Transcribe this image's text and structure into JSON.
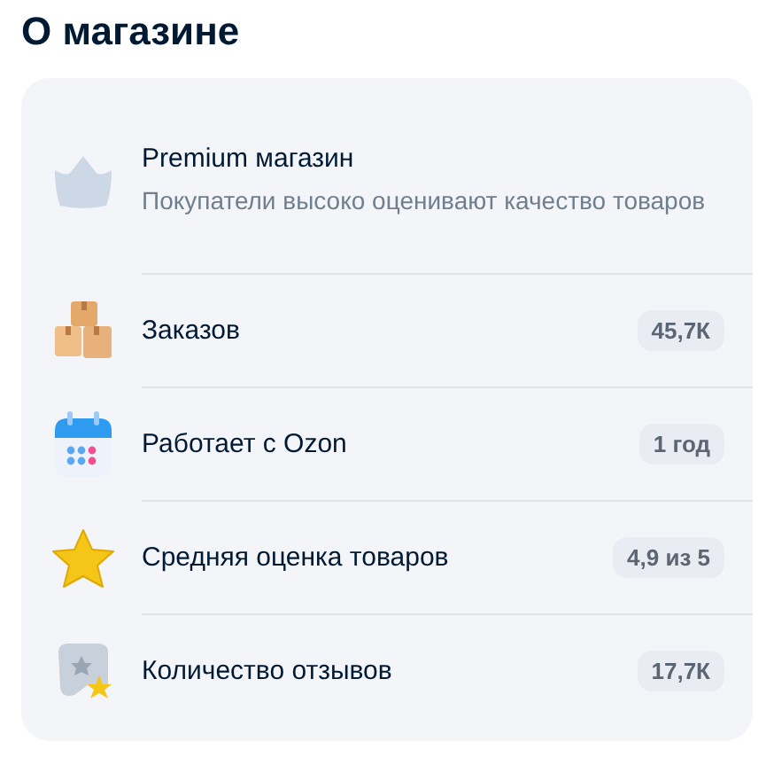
{
  "title": "О магазине",
  "items": [
    {
      "kind": "crown",
      "label": "Premium магазин",
      "description": "Покупатели высоко оценивают качество товаров"
    },
    {
      "kind": "boxes",
      "label": "Заказов",
      "value": "45,7К"
    },
    {
      "kind": "calendar",
      "label": "Работает с Ozon",
      "value": "1 год"
    },
    {
      "kind": "star",
      "label": "Средняя оценка товаров",
      "value": "4,9 из 5"
    },
    {
      "kind": "review",
      "label": "Количество отзывов",
      "value": "17,7К"
    }
  ]
}
